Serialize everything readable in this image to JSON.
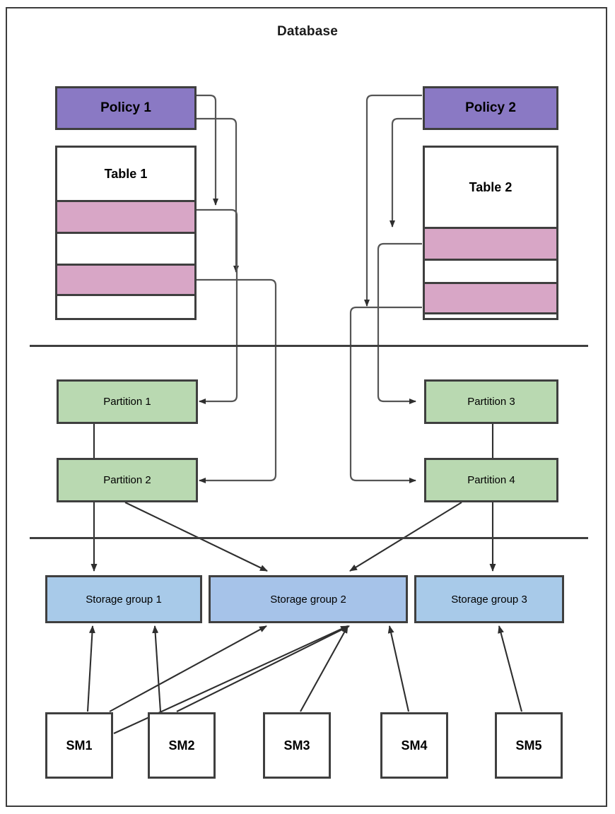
{
  "diagram": {
    "title": "Database",
    "title_label": "Database"
  },
  "layers": {
    "logical": {
      "policies": [
        {
          "id": "policy1",
          "label": "Policy 1"
        },
        {
          "id": "policy2",
          "label": "Policy 2"
        }
      ],
      "tables": [
        {
          "id": "table1",
          "label": "Table 1",
          "rows": [
            {
              "index": 1,
              "highlighted": true
            },
            {
              "index": 2,
              "highlighted": false
            },
            {
              "index": 3,
              "highlighted": true
            },
            {
              "index": 4,
              "highlighted": false
            }
          ]
        },
        {
          "id": "table2",
          "label": "Table 2",
          "rows": [
            {
              "index": 1,
              "highlighted": true
            },
            {
              "index": 2,
              "highlighted": false
            },
            {
              "index": 3,
              "highlighted": true
            },
            {
              "index": 4,
              "highlighted": false
            }
          ]
        }
      ]
    },
    "partitions": [
      {
        "id": "partition1",
        "label": "Partition 1"
      },
      {
        "id": "partition2",
        "label": "Partition 2"
      },
      {
        "id": "partition3",
        "label": "Partition 3"
      },
      {
        "id": "partition4",
        "label": "Partition 4"
      }
    ],
    "storage_groups": [
      {
        "id": "sg1",
        "label": "Storage group 1"
      },
      {
        "id": "sg2",
        "label": "Storage group 2"
      },
      {
        "id": "sg3",
        "label": "Storage group 3"
      }
    ],
    "storage_modules": [
      {
        "id": "sm1",
        "label": "SM1"
      },
      {
        "id": "sm2",
        "label": "SM2"
      },
      {
        "id": "sm3",
        "label": "SM3"
      },
      {
        "id": "sm4",
        "label": "SM4"
      },
      {
        "id": "sm5",
        "label": "SM5"
      }
    ]
  },
  "colors": {
    "policy_fill": "#8a79c4",
    "table_fill": "#ffffff",
    "table_row_highlight": "#d8a6c6",
    "partition_fill": "#b9d9b1",
    "storage_group_fill": "#a8cae9",
    "storage_group_fill_alt": "#a6c3e9",
    "module_fill": "#ffffff",
    "stroke": "#3f3f3f",
    "connector_stroke": "#555555",
    "background": "#ffffff"
  },
  "connections": {
    "policy_to_table": [
      {
        "from": "policy1",
        "to": "table1_row1"
      },
      {
        "from": "policy1",
        "to": "table1_row3"
      },
      {
        "from": "policy2",
        "to": "table2_row1"
      },
      {
        "from": "policy2",
        "to": "table2_row3"
      }
    ],
    "table_to_partition": [
      {
        "from": "table1_row1",
        "to": "partition1"
      },
      {
        "from": "table1_row3",
        "to": "partition2"
      },
      {
        "from": "table2_row1",
        "to": "partition3"
      },
      {
        "from": "table2_row3",
        "to": "partition4"
      }
    ],
    "partition_to_storage_group": [
      {
        "from": "partition1",
        "to": "sg1"
      },
      {
        "from": "partition2",
        "to": "sg2"
      },
      {
        "from": "partition3",
        "to": "sg2"
      },
      {
        "from": "partition4",
        "to": "sg3"
      }
    ],
    "module_to_storage_group": [
      {
        "from": "sm1",
        "to": "sg1"
      },
      {
        "from": "sm1",
        "to": "sg2"
      },
      {
        "from": "sm1",
        "to": "sg2"
      },
      {
        "from": "sm2",
        "to": "sg1"
      },
      {
        "from": "sm2",
        "to": "sg2"
      },
      {
        "from": "sm3",
        "to": "sg2"
      },
      {
        "from": "sm4",
        "to": "sg2"
      },
      {
        "from": "sm5",
        "to": "sg3"
      }
    ]
  }
}
